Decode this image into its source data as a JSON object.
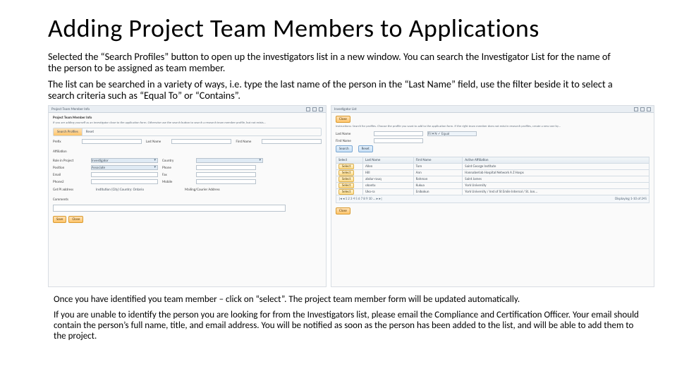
{
  "title": "Adding Project Team Members to Applications",
  "para1": "Selected the “Search Profiles” button to open up the investigators list in a new window. You can search the Investigator List for the name of the person to be assigned as team member.",
  "para2": "The list can be searched in a variety of ways, i.e. type the last name of the person in the “Last Name” field, use the filter beside it to select a search criteria such as “Equal To” or “Contains”.",
  "footer1": "Once you have identified you team member – click on “select”. The project team member form will be updated automatically.",
  "footer2": "If you are unable to identify the person you are looking for from the Investigators list, please email the Compliance and Certification Officer. Your email should contain the person’s full name, title, and email address. You will be notified as soon as the person has been added to the list, and will be able to add them to the project.",
  "left": {
    "winTitle": "Project Team Member Info",
    "header": "Project Team Member Info",
    "instr": "If you are adding yourself as an Investigator close to the application form. Otherwise use the search button to search a research team member profile, but not exists...",
    "tabs": {
      "a": "Search Profiles",
      "b": "Reset"
    },
    "labels": {
      "prefix": "Prefix",
      "lastname": "Last Name",
      "firstname": "First Name",
      "affiliation": "Affiliation",
      "role": "Role in Project",
      "country": "Country",
      "position": "Position",
      "phone": "Phone",
      "email": "Email",
      "fax": "Fax",
      "phone2": "Phone2",
      "mobile": "Mobile",
      "primaddr": "Get PI address",
      "mailaddr": "Mailing/Courier Address",
      "institution": "Institution (City)   Country: Ontario",
      "comments": "Comments"
    },
    "values": {
      "role": "Investigator",
      "position": "Associate"
    },
    "buttons": {
      "save": "Save",
      "close": "Close"
    }
  },
  "right": {
    "winTitle": "Investigator List",
    "closeBtn": "Close",
    "instr": "Instructions: Search for profiles. Choose the profile you want to add to the application form. If the right team member does not exist in research profiles, create a new one by...",
    "search": {
      "lastname": "Last Name",
      "filter": "Fil ▾ N ✓ Equal",
      "firstname": "First Name",
      "searchBtn": "Search",
      "resetBtn": "Reset"
    },
    "table": {
      "cols": {
        "select": "Select",
        "last": "Last Name",
        "first": "First Name",
        "aff": "Active Affiliation"
      },
      "rows": [
        {
          "sel": "Select",
          "last": "Allen",
          "first": "Tom",
          "aff": "Saint George Institute"
        },
        {
          "sel": "Select",
          "last": "Hill",
          "first": "Ann",
          "aff": "Hannaberlab Hospital Network A Z Hosps"
        },
        {
          "sel": "Select",
          "last": "abdur-rauq",
          "first": "Rahman",
          "aff": "Saint James"
        },
        {
          "sel": "Select",
          "last": "obantu",
          "first": "Kukua",
          "aff": "York University"
        },
        {
          "sel": "Select",
          "last": "Uko-ra",
          "first": "Enibokun",
          "aff": "York University / Inst of St Emile Internal / St. Jon..."
        }
      ],
      "pager": {
        "nav": "|◂ ◂ 1 2 3 4 5 6 7 8 9 10 ... ▸ ▸|",
        "info": "Displaying 1-10 of 245"
      }
    },
    "bottomClose": "Close"
  }
}
